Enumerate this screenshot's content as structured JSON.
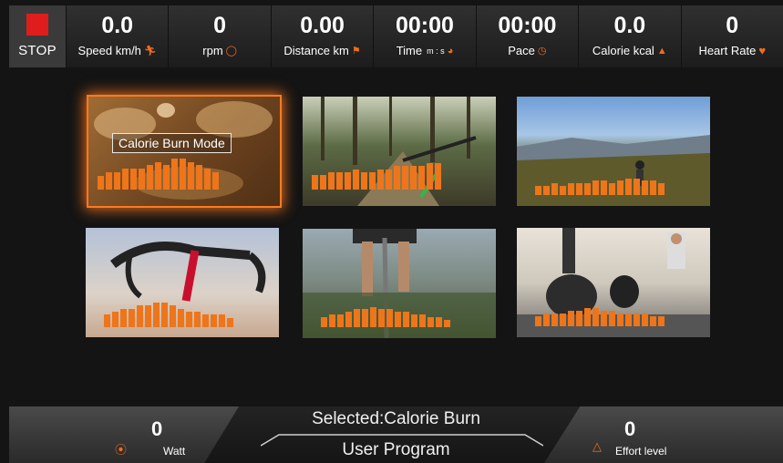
{
  "stop": {
    "label": "STOP"
  },
  "stats": [
    {
      "value": "0.0",
      "label": "Speed km/h",
      "icon": "runner-icon"
    },
    {
      "value": "0",
      "label": "rpm",
      "icon": "rpm-icon"
    },
    {
      "value": "0.00",
      "label": "Distance km",
      "icon": "distance-icon"
    },
    {
      "value": "00:00",
      "label": "Time",
      "sub": "m : s",
      "icon": "clock-icon"
    },
    {
      "value": "00:00",
      "label": "Pace",
      "icon": "pace-icon"
    },
    {
      "value": "0.0",
      "label": "Calorie kcal",
      "icon": "flame-icon"
    },
    {
      "value": "0",
      "label": "Heart Rate",
      "icon": "heart-icon"
    }
  ],
  "programs": [
    {
      "name": "Calorie Burn Mode",
      "selected": true,
      "scene": "food",
      "profile": [
        4,
        5,
        5,
        6,
        6,
        6,
        7,
        8,
        7,
        9,
        9,
        8,
        7,
        6,
        5
      ]
    },
    {
      "name": "",
      "selected": false,
      "scene": "forest-trail",
      "profile": [
        5,
        5,
        6,
        6,
        6,
        7,
        6,
        6,
        7,
        7,
        8,
        8,
        8,
        8,
        9,
        9
      ]
    },
    {
      "name": "",
      "selected": false,
      "scene": "hill-rider",
      "profile": [
        4,
        4,
        5,
        4,
        5,
        5,
        5,
        6,
        6,
        5,
        6,
        7,
        7,
        6,
        6,
        5
      ]
    },
    {
      "name": "",
      "selected": false,
      "scene": "road-bike",
      "profile": [
        4,
        5,
        6,
        6,
        7,
        7,
        8,
        8,
        7,
        6,
        5,
        5,
        4,
        4,
        4,
        3
      ]
    },
    {
      "name": "",
      "selected": false,
      "scene": "cyclist-legs",
      "profile": [
        4,
        5,
        5,
        6,
        7,
        7,
        8,
        7,
        7,
        6,
        6,
        5,
        5,
        4,
        4,
        3
      ]
    },
    {
      "name": "",
      "selected": false,
      "scene": "gym",
      "profile": [
        4,
        5,
        5,
        5,
        6,
        6,
        7,
        7,
        6,
        6,
        5,
        5,
        5,
        5,
        4,
        4
      ]
    }
  ],
  "bottom": {
    "watt_value": "0",
    "watt_label": "Watt",
    "watt_icon": "watt-icon",
    "selected_text": "Selected:Calorie Burn",
    "program_label": "User Program",
    "effort_value": "0",
    "effort_label": "Effort level",
    "effort_icon": "effort-icon"
  },
  "colors": {
    "accent": "#f26c1c",
    "bar": "#ee7519",
    "stop": "#e01d1d"
  }
}
